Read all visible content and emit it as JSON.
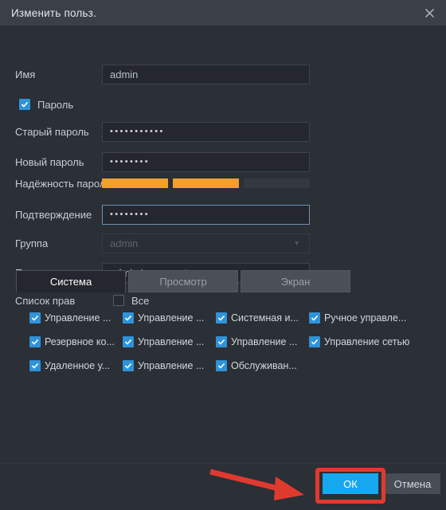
{
  "window": {
    "title": "Изменить польз.",
    "close_icon": "close-icon"
  },
  "form": {
    "name": {
      "label": "Имя",
      "value": "admin"
    },
    "password_toggle": {
      "label": "Пароль",
      "checked": true
    },
    "old_password": {
      "label": "Старый пароль",
      "value": "•••••••••••"
    },
    "new_password": {
      "label": "Новый пароль",
      "value": "••••••••"
    },
    "strength": {
      "label": "Надёжность пароля",
      "segments_total": 3,
      "segments_filled": 2,
      "fill_color": "#f2a02b",
      "empty_color": "#34383f"
    },
    "confirm": {
      "label": "Подтверждение",
      "value": "••••••••",
      "focused": true
    },
    "group": {
      "label": "Группа",
      "value": "admin",
      "disabled": true,
      "chevron_icon": "chevron-down-icon"
    },
    "hint": {
      "label": "Подсказка",
      "value": "admin 's account"
    },
    "rights": {
      "label": "Список прав",
      "all_label": "Все",
      "all_checked": false
    }
  },
  "tabs": [
    {
      "label": "Система",
      "active": true
    },
    {
      "label": "Просмотр",
      "active": false
    },
    {
      "label": "Экран",
      "active": false
    }
  ],
  "permissions": [
    {
      "label": "Управление ...",
      "checked": true
    },
    {
      "label": "Управление ...",
      "checked": true
    },
    {
      "label": "Системная и...",
      "checked": true
    },
    {
      "label": "Ручное управле...",
      "checked": true
    },
    {
      "label": "Резервное ко...",
      "checked": true
    },
    {
      "label": "Управление ...",
      "checked": true
    },
    {
      "label": "Управление ...",
      "checked": true
    },
    {
      "label": "Управление сетью",
      "checked": true
    },
    {
      "label": "Удаленное у...",
      "checked": true
    },
    {
      "label": "Управление ...",
      "checked": true
    },
    {
      "label": "Обслуживан...",
      "checked": true
    }
  ],
  "footer": {
    "ok_label": "ОК",
    "cancel_label": "Отмена",
    "ok_color": "#17a7ef",
    "cancel_color": "#474c55"
  },
  "annotations": {
    "highlight_color": "#e03a2f",
    "arrow_icon": "arrow-right-icon",
    "box_icon": "highlight-box"
  }
}
